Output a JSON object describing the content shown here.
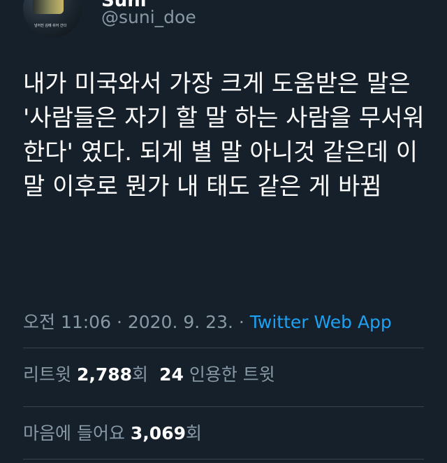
{
  "tweet": {
    "author": {
      "display_name": "Suni",
      "handle": "@suni_doe",
      "avatar_caption": "넘어진 김에 쉬어 간다"
    },
    "text": "내가 미국와서 가장 크게 도움받은 말은 '사람들은 자기 할 말 하는 사람을 무서워한다' 였다. 되게 별 말 아니것 같은데 이 말 이후로 뭔가 내 태도 같은 게 바뀜",
    "time": "오전 11:06",
    "separator": " · ",
    "date": "2020. 9. 23.",
    "source": "Twitter Web App",
    "stats": {
      "retweets_label": "리트윗",
      "retweets_count": "2,788",
      "retweets_suffix": "회",
      "quotes_count": "24",
      "quotes_label": "인용한 트윗",
      "likes_label": "마음에 들어요",
      "likes_count": "3,069",
      "likes_suffix": "회"
    }
  }
}
